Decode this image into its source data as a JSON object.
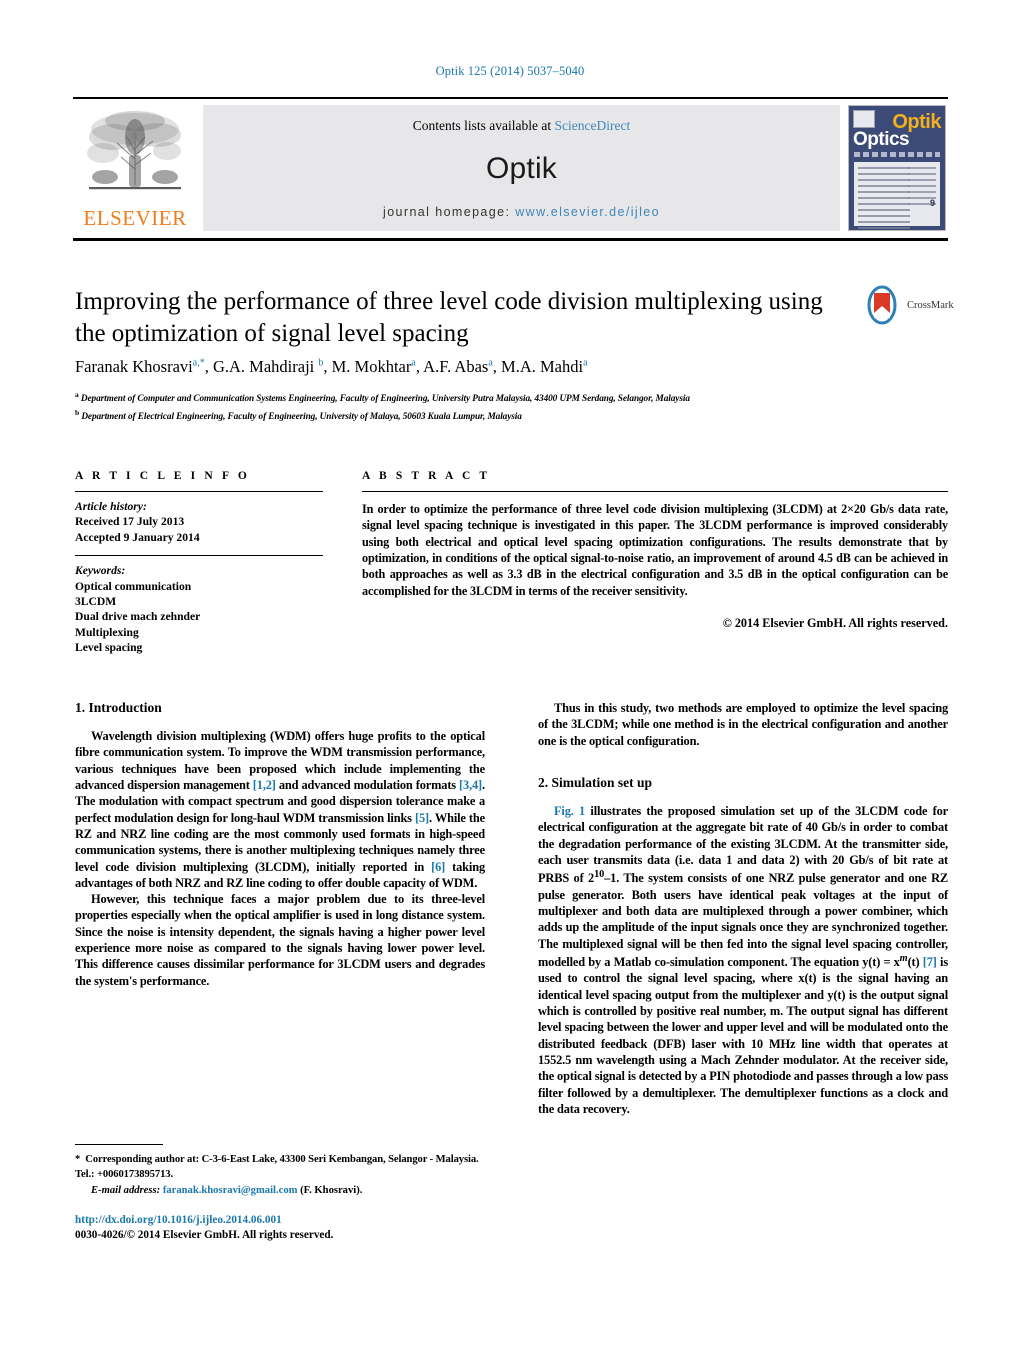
{
  "running_head": "Optik 125 (2014) 5037–5040",
  "masthead": {
    "contents_prefix": "Contents lists available at ",
    "contents_link": "ScienceDirect",
    "journal_name": "Optik",
    "homepage_label": "journal homepage: ",
    "homepage_url": "www.elsevier.de/ijleo",
    "publisher": "ELSEVIER",
    "cover": {
      "line1": "Optik",
      "line2": "Optics",
      "issue_badge": "9"
    }
  },
  "article": {
    "title": "Improving the performance of three level code division multiplexing using the optimization of signal level spacing",
    "crossmark_label": "CrossMark",
    "authors_html": "Faranak Khosravi<sup>a,*</sup>, G.A. Mahdiraji <sup>b</sup>, M. Mokhtar<sup>a</sup>, A.F. Abas<sup>a</sup>, M.A. Mahdi<sup>a</sup>",
    "affiliation_a": "Department of Computer and Communication Systems Engineering, Faculty of Engineering, University Putra Malaysia, 43400 UPM Serdang, Selangor, Malaysia",
    "affiliation_b": "Department of Electrical Engineering, Faculty of Engineering, University of Malaya, 50603 Kuala Lumpur, Malaysia"
  },
  "article_info": {
    "heading": "A R T I C L E   I N F O",
    "history_label": "Article history:",
    "received": "Received 17 July 2013",
    "accepted": "Accepted 9 January 2014",
    "keywords_label": "Keywords:",
    "keywords": [
      "Optical communication",
      "3LCDM",
      "Dual drive mach zehnder",
      "Multiplexing",
      "Level spacing"
    ]
  },
  "abstract": {
    "heading": "A B S T R A C T",
    "text": "In order to optimize the performance of three level code division multiplexing (3LCDM) at 2×20 Gb/s data rate, signal level spacing technique is investigated in this paper. The 3LCDM performance is improved considerably using both electrical and optical level spacing optimization configurations. The results demonstrate that by optimization, in conditions of the optical signal-to-noise ratio, an improvement of around 4.5 dB can be achieved in both approaches as well as 3.3 dB in the electrical configuration and 3.5 dB in the optical configuration can be accomplished for the 3LCDM in terms of the receiver sensitivity.",
    "copyright": "© 2014 Elsevier GmbH. All rights reserved."
  },
  "body": {
    "section1_heading": "1.  Introduction",
    "section1_p1_html": "Wavelength division multiplexing (WDM) offers huge profits to the optical fibre communication system. To improve the WDM transmission performance, various techniques have been proposed which include implementing the advanced dispersion management <span class=\"ref\">[1,2]</span> and advanced modulation formats <span class=\"ref\">[3,4]</span>. The modulation with compact spectrum and good dispersion tolerance make a perfect modulation design for long-haul WDM transmission links <span class=\"ref\">[5]</span>. While the RZ and NRZ line coding are the most commonly used formats in high-speed communication systems, there is another multiplexing techniques namely three level code division multiplexing (3LCDM), initially reported in <span class=\"ref\">[6]</span> taking advantages of both NRZ and RZ line coding to offer double capacity of WDM.",
    "section1_p2_html": "However, this technique faces a major problem due to its three-level properties especially when the optical amplifier is used in long distance system. Since the noise is intensity dependent, the signals having a higher power level experience more noise as compared to the signals having lower power level. This difference causes dissimilar performance for 3LCDM users and degrades the system's performance.",
    "right_p1_html": "Thus in this study, two methods are employed to optimize the level spacing of the 3LCDM; while one method is in the electrical configuration and another one is the optical configuration.",
    "section2_heading": "2.  Simulation set up",
    "section2_p1_html": "<span class=\"ref\">Fig. 1</span> illustrates the proposed simulation set up of the 3LCDM code for electrical configuration at the aggregate bit rate of 40 Gb/s in order to combat the degradation performance of the existing 3LCDM. At the transmitter side, each user transmits data (i.e. data 1 and data 2) with 20 Gb/s of bit rate at PRBS of 2<sup>10</sup>–1. The system consists of one NRZ pulse generator and one RZ pulse generator. Both users have identical peak voltages at the input of multiplexer and both data are multiplexed through a power combiner, which adds up the amplitude of the input signals once they are synchronized together. The multiplexed signal will be then fed into the signal level spacing controller, modelled by a Matlab co-simulation component. The equation y(t) = x<sup><i>m</i></sup>(t) <span class=\"ref\">[7]</span> is used to control the signal level spacing, where x(t) is the signal having an identical level spacing output from the multiplexer and y(t) is the output signal which is controlled by positive real number, m. The output signal has different level spacing between the lower and upper level and will be modulated onto the distributed feedback (DFB) laser with 10 MHz line width that operates at 1552.5 nm wavelength using a Mach Zehnder modulator. At the receiver side, the optical signal is detected by a PIN photodiode and passes through a low pass filter followed by a demultiplexer. The demultiplexer functions as a clock and the data recovery."
  },
  "footnote": {
    "corresponding_html": "<b>*</b>&nbsp; Corresponding author at: C-3-6-East Lake, 43300 Seri Kembangan, Selangor - Malaysia. Tel.: +0060173895713.",
    "email_label": "E-mail address:",
    "email": "faranak.khosravi@gmail.com",
    "email_owner": "(F. Khosravi)."
  },
  "doi_block": {
    "doi": "http://dx.doi.org/10.1016/j.ijleo.2014.06.001",
    "issn_line": "0030-4026/© 2014 Elsevier GmbH. All rights reserved."
  },
  "colors": {
    "link": "#1a78ab",
    "sciencedirect": "#3f87b8",
    "elsevier_orange": "#f07d1a",
    "band_gray": "#e7e7e9"
  }
}
